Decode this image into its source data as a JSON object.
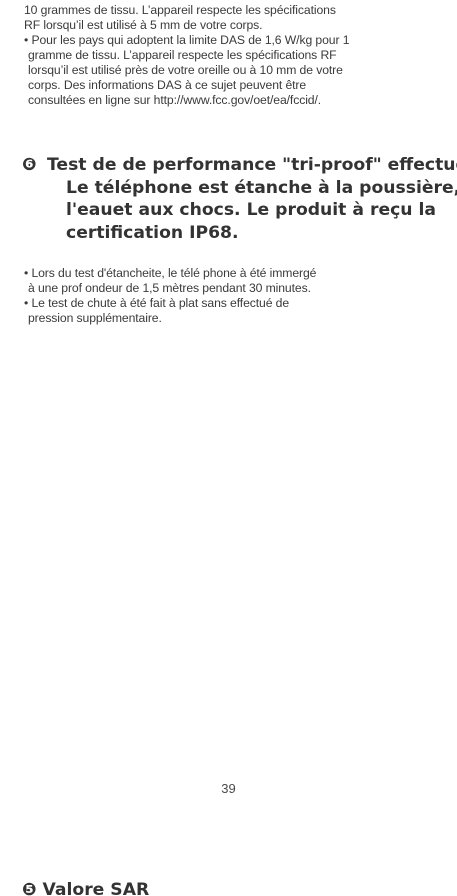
{
  "top_block": {
    "lines": [
      "10 grammes de tissu. L’appareil respecte les spécifications",
      "RF lorsqu’il est utilisé à 5 mm de votre corps."
    ]
  },
  "top_bullet": {
    "lines": [
      "• Pour les pays qui adoptent la limite DAS de 1,6 W/kg pour 1",
      "gramme de tissu. L’appareil respecte les spécifications RF",
      "lorsqu’il est utilisé près de votre oreille ou à 10 mm de votre",
      "corps. Des informations DAS à ce sujet peuvent être",
      "consultées en ligne sur http://www.fcc.gov/oet/ea/fccid/."
    ]
  },
  "section6": {
    "number": "❻",
    "title_lines": [
      "Test de de performance \"tri-proof\" effectué.",
      "Le téléphone est étanche à la poussière, à",
      "l'eauet aux chocs. Le produit à reçu la",
      "certification IP68."
    ]
  },
  "bullets": [
    {
      "lines": [
        "• Lors du test d'étancheite, le télé phone à été immergé",
        "à une prof ondeur de 1,5 mètres pendant 30 minutes."
      ]
    },
    {
      "lines": [
        "• Le test de chute  à été fait à plat sans effectué de",
        "pression supplémentaire."
      ]
    }
  ],
  "footer": {
    "page_number": "39"
  },
  "next_page": {
    "heading": "❺ Valore SAR"
  }
}
